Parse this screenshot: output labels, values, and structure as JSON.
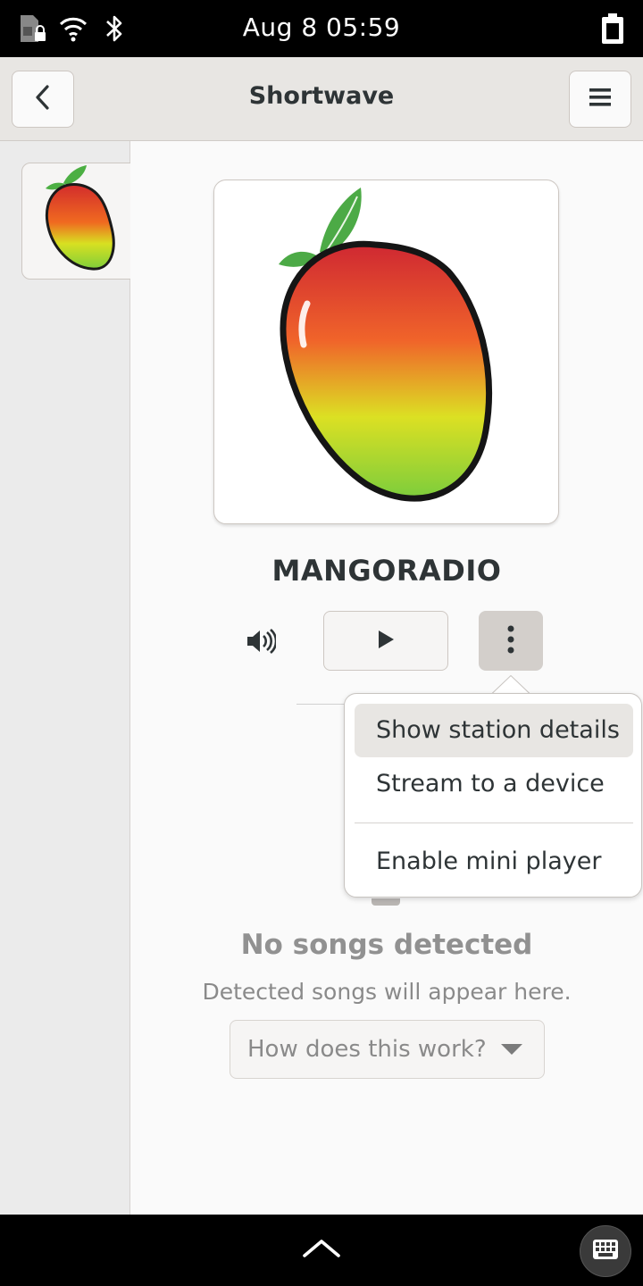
{
  "status_bar": {
    "datetime": "Aug 8  05:59",
    "icons": [
      "sim-locked-icon",
      "wifi-icon",
      "bluetooth-icon",
      "battery-icon"
    ]
  },
  "header": {
    "title": "Shortwave",
    "back_icon": "chevron-left-icon",
    "menu_icon": "hamburger-menu-icon"
  },
  "station": {
    "name": "MANGORADIO",
    "controls": [
      "volume-icon",
      "play-icon",
      "vertical-dots-icon"
    ]
  },
  "popover_menu": {
    "items": [
      {
        "label": "Show station details",
        "highlighted": true
      },
      {
        "label": "Stream to a device",
        "highlighted": false
      },
      {
        "label": "Enable mini player",
        "highlighted": false
      }
    ]
  },
  "song_history": {
    "empty_title": "No songs detected",
    "empty_subtitle": "Detected songs will appear here.",
    "help_label": "How does this work?"
  },
  "bottom_bar": {
    "icons": [
      "chevron-up-icon",
      "keyboard-icon"
    ]
  },
  "colors": {
    "header_bg": "#e8e6e3",
    "text_primary": "#2e3436",
    "text_dim": "#8a8a8a",
    "highlight": "#e8e6e3"
  }
}
